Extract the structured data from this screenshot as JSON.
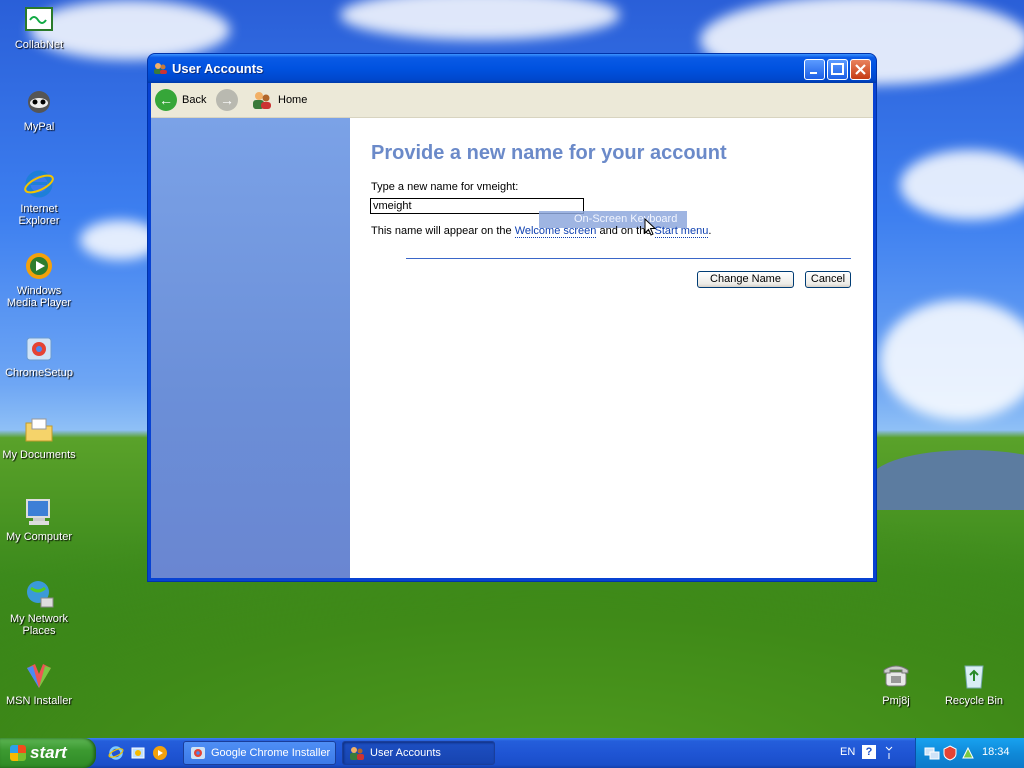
{
  "desktop": {
    "icons": [
      {
        "label": "CollabNet",
        "icon": "collabnet-icon"
      },
      {
        "label": "MyPal",
        "icon": "mypal-icon"
      },
      {
        "label": "Internet Explorer",
        "icon": "internet-explorer-icon"
      },
      {
        "label": "Windows Media Player",
        "icon": "media-player-icon"
      },
      {
        "label": "ChromeSetup",
        "icon": "chrome-setup-icon"
      },
      {
        "label": "My Documents",
        "icon": "folder-icon"
      },
      {
        "label": "My Computer",
        "icon": "computer-icon"
      },
      {
        "label": "My Network Places",
        "icon": "network-icon"
      },
      {
        "label": "MSN Installer",
        "icon": "msn-icon"
      },
      {
        "label": "Pmj8j",
        "icon": "telephone-icon"
      },
      {
        "label": "Recycle Bin",
        "icon": "recycle-bin-icon"
      }
    ]
  },
  "window": {
    "title": "User Accounts",
    "toolbar": {
      "back_label": "Back",
      "home_label": "Home"
    },
    "heading": "Provide a new name for your account",
    "field_label": "Type a new name for vmeight:",
    "field_value": "vmeight",
    "osk_label": "On-Screen Keyboard",
    "desc_prefix": "This name will appear on the ",
    "desc_link1": "Welcome screen",
    "desc_middle": " and on the ",
    "desc_link2": "Start menu",
    "desc_suffix": ".",
    "change_button": "Change Name",
    "cancel_button": "Cancel"
  },
  "taskbar": {
    "start_label": "start",
    "tasks": [
      {
        "label": "Google Chrome Installer"
      },
      {
        "label": "User Accounts"
      }
    ],
    "language": "EN",
    "clock": "18:34"
  },
  "colors": {
    "heading": "#6b8ac9",
    "link": "#0d3fb0",
    "titlebar": "#0052e0"
  }
}
